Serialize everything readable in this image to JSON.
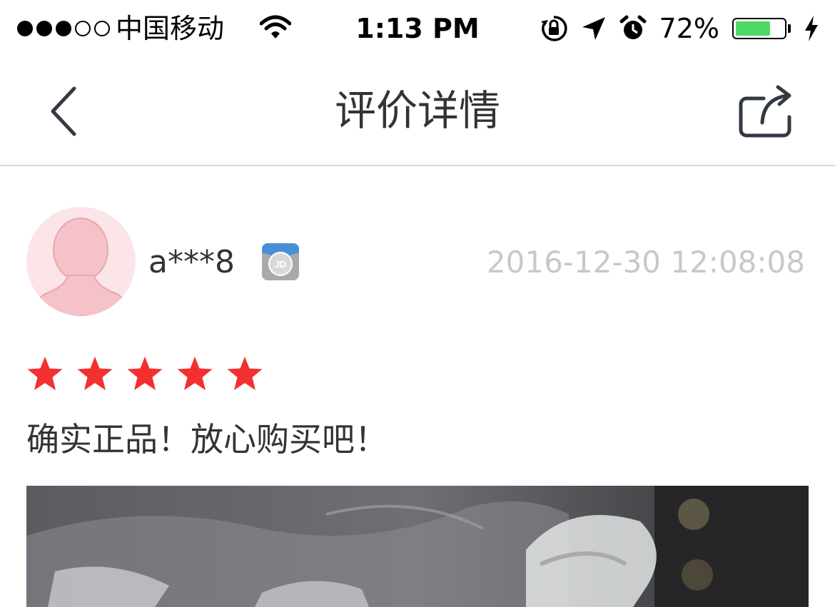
{
  "status_bar": {
    "carrier": "中国移动",
    "time": "1:13 PM",
    "battery_percent_text": "72%",
    "battery_level": 0.72,
    "signal_bars_filled": 3,
    "signal_bars_total": 5,
    "icons": [
      "wifi-icon",
      "orientation-lock-icon",
      "location-arrow-icon",
      "alarm-icon",
      "battery-icon",
      "charging-bolt-icon"
    ]
  },
  "nav": {
    "title": "评价详情",
    "back_icon": "chevron-left-icon",
    "share_icon": "share-icon"
  },
  "review": {
    "username": "a***8",
    "badge_icon": "jd-member-badge-icon",
    "timestamp": "2016-12-30 12:08:08",
    "rating": 5,
    "rating_max": 5,
    "comment": "确实正品！放心购买吧！"
  },
  "colors": {
    "star": "#f23030",
    "battery_fill": "#4cd964",
    "avatar_bg": "#fbe5e8",
    "timestamp": "#c8c8c8",
    "divider": "#d9d9d9"
  }
}
